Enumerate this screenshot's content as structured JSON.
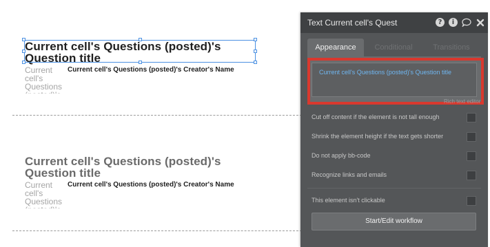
{
  "canvas": {
    "cells": [
      {
        "title": "Current cell's Questions (posted)'s Question title",
        "side_text": "Current cell's Questions (posted)'s",
        "creator": "Current cell's Questions (posted)'s Creator's Name"
      },
      {
        "title": "Current cell's Questions (posted)'s Question title",
        "side_text": "Current cell's Questions (posted)'s",
        "creator": "Current cell's Questions (posted)'s Creator's Name"
      }
    ]
  },
  "panel": {
    "title": "Text Current cell's Quest",
    "header_icons": [
      "help-icon",
      "info-icon",
      "comment-icon",
      "close-icon"
    ],
    "tabs": [
      {
        "label": "Appearance",
        "active": true
      },
      {
        "label": "Conditional",
        "active": false
      },
      {
        "label": "Transitions",
        "active": false
      }
    ],
    "rich_text_value": "Current cell's Questions (posted)'s Question title",
    "rich_text_label": "Rich text editor",
    "options": [
      {
        "label": "Cut off content if the element is not tall enough",
        "checked": false
      },
      {
        "label": "Shrink the element height if the text gets shorter",
        "checked": false
      },
      {
        "label": "Do not apply bb-code",
        "checked": false
      },
      {
        "label": "Recognize links and emails",
        "checked": false
      }
    ],
    "not_clickable": {
      "label": "This element isn't clickable",
      "checked": false
    },
    "workflow_button": "Start/Edit workflow",
    "colors": {
      "panel_bg": "#545658",
      "header_bg": "#3f4143",
      "highlight": "#d9382e",
      "link_text": "#6fb6f0",
      "selection": "#4a90e2"
    }
  }
}
